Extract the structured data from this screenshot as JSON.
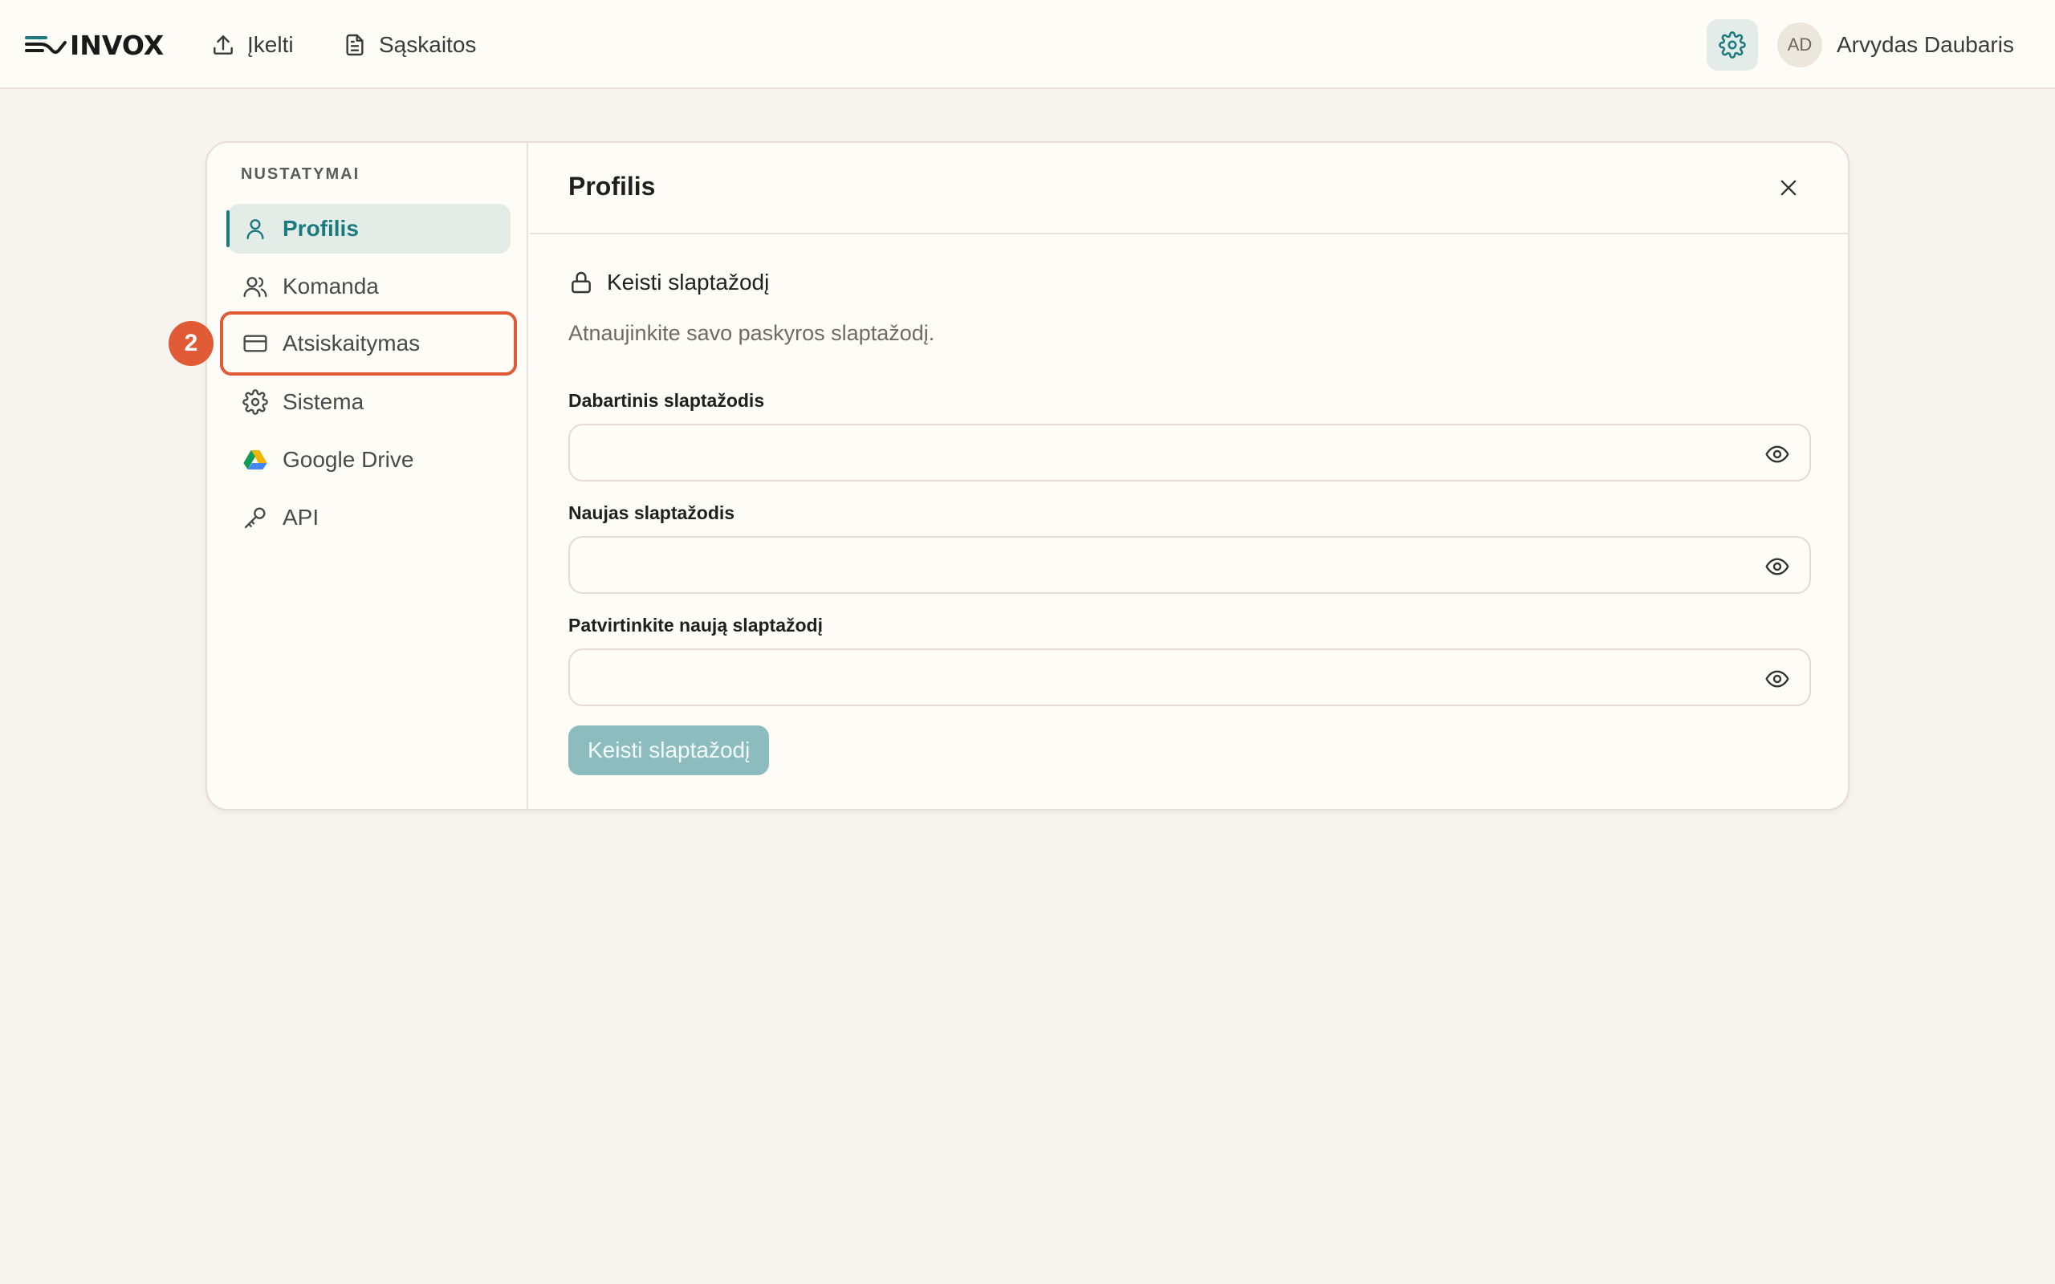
{
  "app": {
    "logo_text": "INVOX",
    "nav": [
      {
        "label": "Įkelti",
        "icon": "upload-icon"
      },
      {
        "label": "Sąskaitos",
        "icon": "document-icon"
      }
    ],
    "user": {
      "initials": "AD",
      "name": "Arvydas Daubaris"
    }
  },
  "sidebar": {
    "heading": "NUSTATYMAI",
    "items": [
      {
        "label": "Profilis",
        "icon": "user-icon",
        "active": true
      },
      {
        "label": "Komanda",
        "icon": "users-icon"
      },
      {
        "label": "Atsiskaitymas",
        "icon": "credit-card-icon",
        "highlighted": true
      },
      {
        "label": "Sistema",
        "icon": "gear-icon"
      },
      {
        "label": "Google Drive",
        "icon": "google-drive-icon"
      },
      {
        "label": "API",
        "icon": "key-icon"
      }
    ],
    "step_badge": "2"
  },
  "panel": {
    "title": "Profilis",
    "section_title": "Keisti slaptažodį",
    "section_desc": "Atnaujinkite savo paskyros slaptažodį.",
    "fields": [
      {
        "label": "Dabartinis slaptažodis",
        "value": ""
      },
      {
        "label": "Naujas slaptažodis",
        "value": ""
      },
      {
        "label": "Patvirtinkite naują slaptažodį",
        "value": ""
      }
    ],
    "submit_label": "Keisti slaptažodį"
  },
  "colors": {
    "accent": "#1b7a80",
    "highlight": "#e05a35",
    "background": "#f7f3ee",
    "surface": "#fdfcf7",
    "button_disabled": "#8dbcbe"
  }
}
